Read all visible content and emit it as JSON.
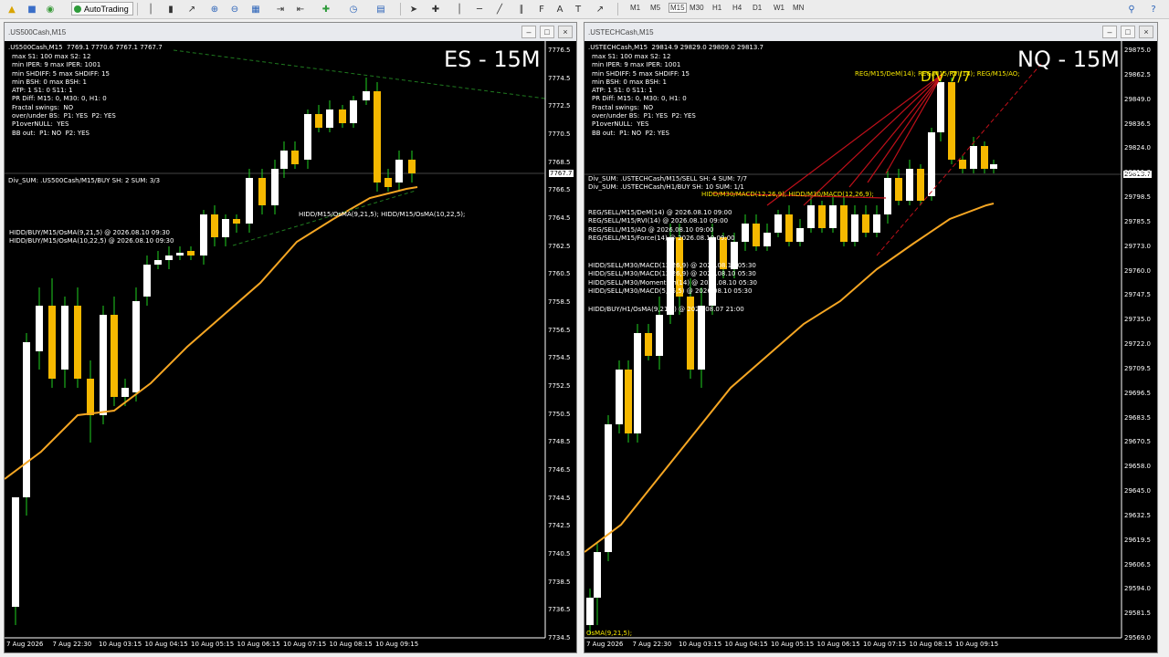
{
  "toolbar": {
    "autotrading_label": "AutoTrading",
    "timeframes": [
      "M1",
      "M5",
      "M15",
      "M30",
      "H1",
      "H4",
      "D1",
      "W1",
      "MN"
    ],
    "active_timeframe": "M15",
    "icons": [
      "open-folder-icon",
      "profiles-icon",
      "market-watch-icon",
      "navigator-icon",
      "autotrading-icon",
      "bar-chart-icon",
      "candlestick-icon",
      "line-chart-icon",
      "zoom-in-icon",
      "zoom-out-icon",
      "tile-windows-icon",
      "scroll-icon",
      "shift-icon",
      "indicators-icon",
      "periods-icon",
      "templates-icon",
      "cursor-icon",
      "crosshair-icon",
      "vertical-line-icon",
      "horizontal-line-icon",
      "trendline-icon",
      "channel-icon",
      "fibonacci-icon",
      "text-icon",
      "label-icon",
      "arrows-icon",
      "search-icon",
      "help-icon"
    ]
  },
  "left": {
    "window_title": ".US500Cash,M15",
    "overlay_label": "ES - 15M",
    "header_line": ".US500Cash,M15  7769.1 7770.6 7767.1 7767.7",
    "info_lines": [
      "max S1: 100 max S2: 12",
      "min IPER: 9 max IPER: 1001",
      "min SHDIFF: 5 max SHDIFF: 15",
      "min BSH: 0 max BSH: 1",
      "ATP: 1 S1: 0 S11: 1",
      "PR Diff: M15: 0, M30: 0, H1: 0",
      "Fractal swings:  NO",
      "over/under BS:  P1: YES  P2: YES",
      "P1overNULL:  YES",
      "BB out:  P1: NO  P2: YES"
    ],
    "div_sum": "Div_SUM: .US500Cash/M15/BUY SH: 2 SUM: 3/3",
    "hidd_lines": [
      "HIDD/BUY/M15/OsMA(9,21,5) @ 2026.08.10 09:30",
      "HIDD/BUY/M15/OsMA(10,22,5) @ 2026.08.10 09:30"
    ],
    "chart_annotation": "HIDD/M15/OsMA(9,21,5); HIDD/M15/OsMA(10,22,5);",
    "current_price": "7767.7",
    "price_axis": [
      "7776.5",
      "7774.5",
      "7772.5",
      "7770.5",
      "7768.5",
      "7766.5",
      "7764.5",
      "7762.5",
      "7760.5",
      "7758.5",
      "7756.5",
      "7754.5",
      "7752.5",
      "7750.5",
      "7748.5",
      "7746.5",
      "7744.5",
      "7742.5",
      "7740.5",
      "7738.5",
      "7736.5",
      "7734.5"
    ],
    "time_axis": [
      "7 Aug 2026",
      "7 Aug 22:30",
      "10 Aug 03:15",
      "10 Aug 04:15",
      "10 Aug 05:15",
      "10 Aug 06:15",
      "10 Aug 07:15",
      "10 Aug 08:15",
      "10 Aug 09:15"
    ]
  },
  "right": {
    "window_title": ".USTECHCash,M15",
    "overlay_label": "NQ - 15M",
    "div_label": "DIV 7/7",
    "header_line": ".USTECHCash,M15  29814.9 29829.0 29809.0 29813.7",
    "info_lines": [
      "max S1: 100 max S2: 12",
      "min IPER: 9 max IPER: 1001",
      "min SHDIFF: 5 max SHDIFF: 15",
      "min BSH: 0 max BSH: 1",
      "ATP: 1 S1: 0 S11: 1",
      "PR Diff: M15: 0, M30: 0, H1: 0",
      "Fractal swings:  NO",
      "over/under BS:  P1: YES  P2: YES",
      "P1overNULL:  YES",
      "BB out:  P1: NO  P2: YES"
    ],
    "div_sum_lines": [
      "Div_SUM: .USTECHCash/M15/SELL SH: 4 SUM: 7/7",
      "Div_SUM: .USTECHCash/H1/BUY SH: 10 SUM: 1/1"
    ],
    "reg_lines": [
      "REG/SELL/M15/DeM(14) @ 2026.08.10 09:00",
      "REG/SELL/M15/RVI(14) @ 2026.08.10 09:00",
      "REG/SELL/M15/AO @ 2026.08.10 09:00",
      "REG/SELL/M15/Force(14) @ 2026.08.10 09:00"
    ],
    "hidd_sell_lines": [
      "HIDD/SELL/M30/MACD(12,26,9) @ 2026.08.10 05:30",
      "HIDD/SELL/M30/MACD(12,26,9) @ 2026.08.10 05:30",
      "HIDD/SELL/M30/Momentum(14) @ 2026.08.10 05:30",
      "HIDD/SELL/M30/MACD(5,35,5) @ 2026.08.10 05:30"
    ],
    "hidd_buy_line": "HIDD/BUY/H1/OsMA(9,21,5) @ 2026.08.07 21:00",
    "top_annotation": "REG/M15/DeM(14); REG/M15/RVI(14); REG/M15/AO;",
    "mid_annotation": "HIDD/M30/MACD(12,26,9); HIDD/M30/MACD(12,26,9);",
    "bottom_annotation": "OsMA(9,21,5);",
    "current_price": "29813.7",
    "price_axis": [
      "29875.0",
      "29862.5",
      "29849.0",
      "29836.5",
      "29824.0",
      "29811.0",
      "29798.5",
      "29785.5",
      "29773.0",
      "29760.0",
      "29747.5",
      "29735.0",
      "29722.0",
      "29709.5",
      "29696.5",
      "29683.5",
      "29670.5",
      "29658.0",
      "29645.0",
      "29632.5",
      "29619.5",
      "29606.5",
      "29594.0",
      "29581.5",
      "29569.0"
    ],
    "time_axis": [
      "7 Aug 2026",
      "7 Aug 22:30",
      "10 Aug 03:15",
      "10 Aug 04:15",
      "10 Aug 05:15",
      "10 Aug 06:15",
      "10 Aug 07:15",
      "10 Aug 08:15",
      "10 Aug 09:15"
    ]
  },
  "colors": {
    "bull_body": "#ffffff",
    "bear_body": "#f5b800",
    "wick": "#20d020",
    "ma_line": "#f5a623",
    "reg_line": "#c0101a",
    "annotation_yellow": "#f5e600",
    "trend_dash": "#1f7a1f"
  }
}
